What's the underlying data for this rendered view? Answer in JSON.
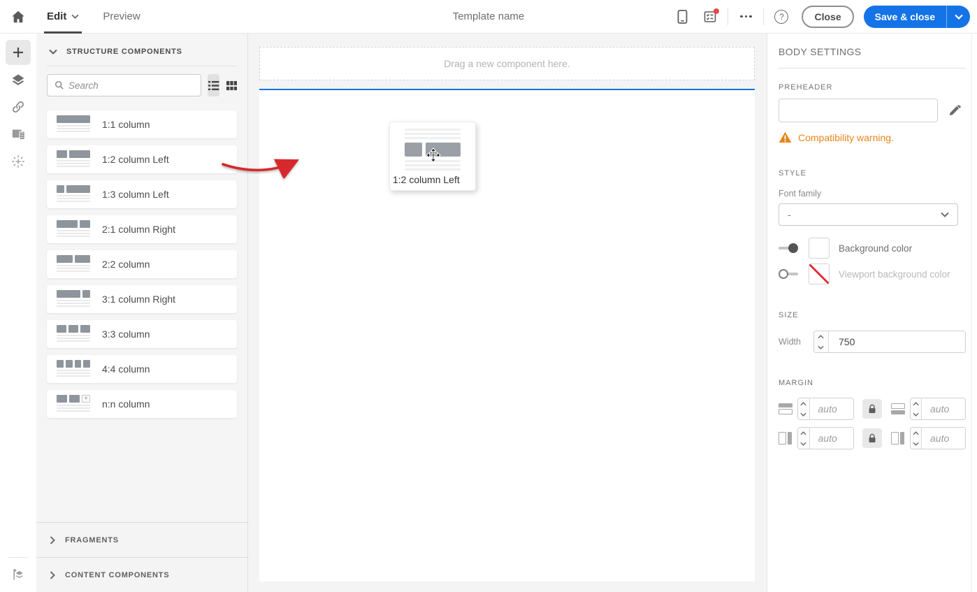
{
  "topbar": {
    "edit_tab": "Edit",
    "preview_tab": "Preview",
    "title": "Template name",
    "help_glyph": "?",
    "close_label": "Close",
    "save_label": "Save & close",
    "icons": [
      "home-icon",
      "chevron-down-icon",
      "mobile-preview-icon",
      "review-checklist-icon",
      "notification-dot",
      "more-actions-icon",
      "help-icon"
    ]
  },
  "rail": {
    "icons": [
      "add-content-icon",
      "layers-icon",
      "link-icon",
      "assets-icon",
      "components-sparkle-icon",
      "structure-tree-icon"
    ]
  },
  "left_panel": {
    "structure_header": "STRUCTURE COMPONENTS",
    "search": {
      "placeholder": "Search"
    },
    "view_toggle": [
      "list-view-icon",
      "grid-view-icon"
    ],
    "components": [
      {
        "label": "1:1 column",
        "cols": [
          1
        ]
      },
      {
        "label": "1:2 column Left",
        "cols": [
          1,
          2
        ]
      },
      {
        "label": "1:3 column Left",
        "cols": [
          1,
          3
        ]
      },
      {
        "label": "2:1 column Right",
        "cols": [
          2,
          1
        ]
      },
      {
        "label": "2:2 column",
        "cols": [
          1,
          1
        ]
      },
      {
        "label": "3:1 column Right",
        "cols": [
          3,
          1
        ]
      },
      {
        "label": "3:3 column",
        "cols": [
          1,
          1,
          1
        ]
      },
      {
        "label": "4:4 column",
        "cols": [
          1,
          1,
          1,
          1
        ]
      },
      {
        "label": "n:n column",
        "cols": [
          1,
          1
        ],
        "plus": true
      }
    ],
    "fragments_header": "FRAGMENTS",
    "content_components_header": "CONTENT COMPONENTS"
  },
  "canvas": {
    "dropzone_text": "Drag a new component here.",
    "drag_ghost": {
      "label": "1:2 column Left",
      "cols": [
        1,
        2
      ]
    }
  },
  "right_panel": {
    "title": "BODY SETTINGS",
    "preheader": {
      "label": "PREHEADER",
      "value": "",
      "warning": "Compatibility warning."
    },
    "style": {
      "header": "STYLE",
      "font_family_label": "Font family",
      "font_family_value": "-",
      "background_color": {
        "label": "Background color",
        "enabled": true
      },
      "viewport_background_color": {
        "label": "Viewport background color",
        "enabled": false
      }
    },
    "size": {
      "header": "SIZE",
      "width_label": "Width",
      "width_value": "750"
    },
    "margin": {
      "header": "MARGIN",
      "placeholder": "auto",
      "values": [
        "auto",
        "auto",
        "auto",
        "auto"
      ]
    }
  },
  "colors": {
    "accent_blue": "#1473e6",
    "drop_indicator_blue": "#1473e6",
    "warning_orange": "#e68619",
    "notification_red": "#e34850",
    "drag_arrow_red": "#d7282d"
  }
}
